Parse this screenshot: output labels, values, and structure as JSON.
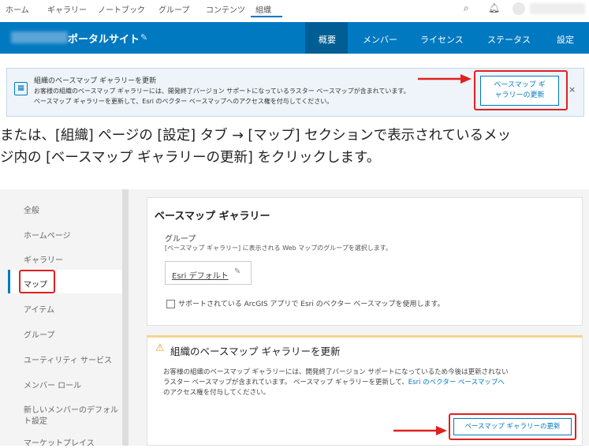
{
  "topnav": {
    "items": [
      "ホーム",
      "ギャラリー",
      "ノートブック",
      "グループ",
      "コンテンツ",
      "組織"
    ],
    "active": "組織"
  },
  "header": {
    "portal_title": "ポータルサイト",
    "tabs": [
      "概要",
      "メンバー",
      "ライセンス",
      "ステータス",
      "設定"
    ],
    "active_tab": "概要"
  },
  "banner": {
    "title": "組織のベースマップ ギャラリーを更新",
    "body_line1": "お客様の組織のベースマップ ギャラリーには、開発終了バージョン サポートになっているラスター ベースマップが含まれています。",
    "body_line2": "ベースマップ ギャラリーを更新して、Esri のベクター ベースマップへのアクセス権を付与してください。",
    "button_line1": "ベースマップ ギ",
    "button_line2": "ャラリーの更新",
    "close": "×"
  },
  "instruction": {
    "line1": "または、[組織] ページの [設定] タブ → [マップ] セクションで表示されているメッ",
    "line2": "ジ内の [ベースマップ ギャラリーの更新] をクリックします。"
  },
  "sidebar": {
    "items": [
      "全般",
      "ホームページ",
      "ギャラリー",
      "マップ",
      "アイテム",
      "グループ",
      "ユーティリティ サービス",
      "メンバー ロール",
      "新しいメンバーのデフォル",
      "ト設定",
      "マーケットプレイス"
    ],
    "active": "マップ"
  },
  "basemap": {
    "title": "ベースマップ ギャラリー",
    "group_label": "グループ",
    "group_desc": "[ベースマップ ギャラリー] に表示される Web マップのグループを選択します。",
    "group_value": "Esri デフォルト",
    "checkbox_label": "サポートされている ArcGIS アプリで Esri のベクター ベースマップを使用します。"
  },
  "warning": {
    "title": "組織のベースマップ ギャラリーを更新",
    "body_line1": "お客様の組織のベースマップ ギャラリーには、開発終了バージョン サポートになっているため今後は更新されない",
    "body_line2_a": "ラスター ベースマップが含まれています。 ベースマップ ギャラリーを更新して、",
    "body_line2_link": "Esri のベクター ベースマップへ",
    "body_line3": "のアクセス権を付与してください。",
    "button": "ベースマップ ギャラリーの更新"
  },
  "colors": {
    "brand_blue": "#0079c1",
    "highlight_red": "#e02020",
    "warning_yellow": "#e8a317"
  }
}
